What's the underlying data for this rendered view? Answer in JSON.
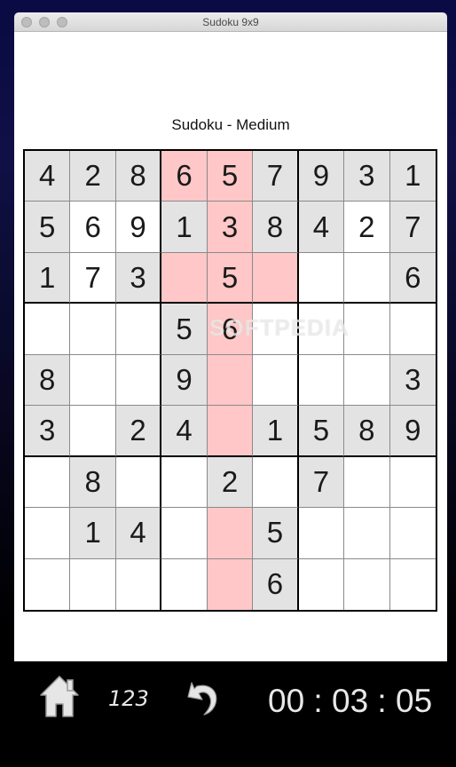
{
  "window": {
    "title": "Sudoku 9x9"
  },
  "puzzle": {
    "title": "Sudoku - Medium"
  },
  "watermark": "SOFTPEDIA",
  "grid": [
    [
      "4",
      "2",
      "8",
      "6",
      "5",
      "7",
      "9",
      "3",
      "1"
    ],
    [
      "5",
      "6",
      "9",
      "1",
      "3",
      "8",
      "4",
      "2",
      "7"
    ],
    [
      "1",
      "7",
      "3",
      "",
      "5",
      "",
      "",
      "",
      "6"
    ],
    [
      "",
      "",
      "",
      "5",
      "6",
      "",
      "",
      "",
      ""
    ],
    [
      "8",
      "",
      "",
      "9",
      "",
      "",
      "",
      "",
      "3"
    ],
    [
      "3",
      "",
      "2",
      "4",
      "",
      "1",
      "5",
      "8",
      "9"
    ],
    [
      "",
      "8",
      "",
      "",
      "2",
      "",
      "7",
      "",
      ""
    ],
    [
      "",
      "1",
      "4",
      "",
      "",
      "5",
      "",
      "",
      ""
    ],
    [
      "",
      "",
      "",
      "",
      "",
      "6",
      "",
      "",
      ""
    ]
  ],
  "given": [
    [
      1,
      1,
      1,
      0,
      0,
      1,
      1,
      1,
      1
    ],
    [
      1,
      0,
      0,
      1,
      0,
      1,
      1,
      0,
      1
    ],
    [
      1,
      0,
      1,
      0,
      0,
      0,
      0,
      0,
      1
    ],
    [
      0,
      0,
      0,
      1,
      0,
      0,
      0,
      0,
      0
    ],
    [
      1,
      0,
      0,
      1,
      0,
      0,
      0,
      0,
      1
    ],
    [
      1,
      0,
      1,
      1,
      0,
      1,
      1,
      1,
      1
    ],
    [
      0,
      1,
      0,
      0,
      1,
      0,
      1,
      0,
      0
    ],
    [
      0,
      1,
      1,
      0,
      0,
      1,
      0,
      0,
      0
    ],
    [
      0,
      0,
      0,
      0,
      0,
      1,
      0,
      0,
      0
    ]
  ],
  "highlight": [
    [
      0,
      0,
      0,
      1,
      1,
      0,
      0,
      0,
      0
    ],
    [
      0,
      0,
      0,
      0,
      1,
      0,
      0,
      0,
      0
    ],
    [
      0,
      0,
      0,
      1,
      1,
      1,
      0,
      0,
      0
    ],
    [
      0,
      0,
      0,
      0,
      1,
      0,
      0,
      0,
      0
    ],
    [
      0,
      0,
      0,
      0,
      1,
      0,
      0,
      0,
      0
    ],
    [
      0,
      0,
      0,
      0,
      1,
      0,
      0,
      0,
      0
    ],
    [
      0,
      0,
      0,
      0,
      0,
      0,
      0,
      0,
      0
    ],
    [
      0,
      0,
      0,
      0,
      1,
      0,
      0,
      0,
      0
    ],
    [
      0,
      0,
      0,
      0,
      1,
      0,
      0,
      0,
      0
    ]
  ],
  "colors": {
    "highlight": "#ffc7c7",
    "given": "#e3e3e3",
    "empty": "#ffffff"
  },
  "toolbar": {
    "home_icon": "home-icon",
    "digits_label": "123",
    "undo_icon": "undo-icon",
    "timer": "00 : 03 : 05"
  }
}
